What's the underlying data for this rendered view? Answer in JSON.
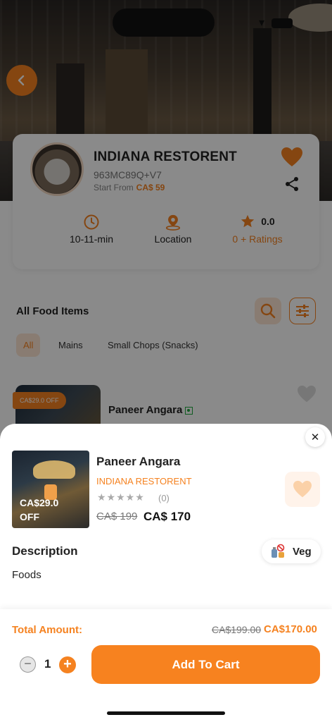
{
  "restaurant": {
    "name": "INDIANA RESTORENT",
    "code": "963MC89Q+V7",
    "start_label": "Start From",
    "start_price": "CA$ 59",
    "time": "10-11-min",
    "location_label": "Location",
    "rating": "0.0",
    "ratings_text": "0 + Ratings"
  },
  "menu": {
    "section_title": "All Food Items",
    "chips": [
      "All",
      "Mains",
      "Small Chops (Snacks)"
    ],
    "active_chip": "All"
  },
  "food_card": {
    "name": "Paneer Angara",
    "off_tag": "CA$29.0 OFF"
  },
  "product": {
    "name": "Paneer Angara",
    "restaurant": "INDIANA RESTORENT",
    "rating_count": "(0)",
    "old_price": "CA$ 199",
    "new_price": "CA$ 170",
    "discount_line1": "CA$29.0",
    "discount_line2": "OFF",
    "description_title": "Description",
    "description": "Foods",
    "veg_label": "Veg",
    "rating_stars": 0
  },
  "cart": {
    "total_label": "Total Amount:",
    "total_old": "CA$199.00",
    "total_new": "CA$170.00",
    "quantity": "1",
    "add_label": "Add To Cart"
  },
  "colors": {
    "accent": "#f58220",
    "veg_green": "#1faa3e"
  }
}
